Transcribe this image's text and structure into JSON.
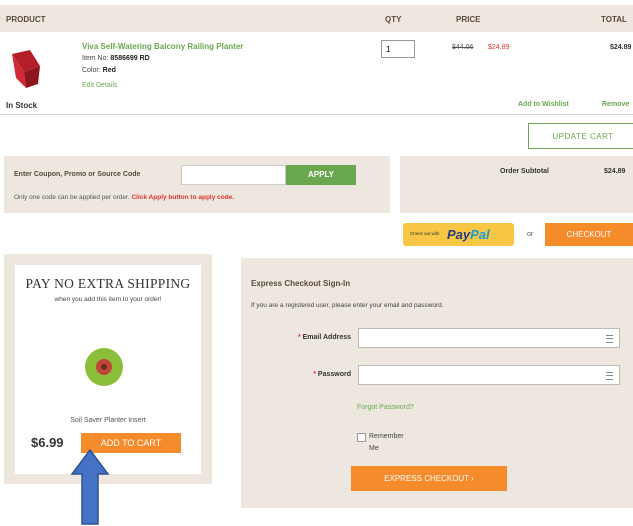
{
  "table_header": {
    "product": "PRODUCT",
    "qty": "QTY",
    "price": "PRICE",
    "total": "TOTAL"
  },
  "item": {
    "name": "Viva Self-Watering Balcony Railing Planter",
    "item_no_label": "Item No:",
    "item_no": "8586699 RD",
    "color_label": "Color:",
    "color": "Red",
    "edit_link": "Edit Details",
    "qty": "1",
    "price_old": "$44.06",
    "price_new": "$24.89",
    "total": "$24.89",
    "stock": "In Stock",
    "wishlist_link": "Add to Wishlist",
    "remove_link": "Remove"
  },
  "update_cart": "UPDATE CART",
  "coupon": {
    "label": "Enter Coupon, Promo or Source Code",
    "placeholder": "",
    "apply": "APPLY",
    "note": "Only one code can be applied per order.",
    "note_highlight": "Click Apply button to apply code."
  },
  "summary": {
    "subtotal_label": "Order Subtotal",
    "subtotal_value": "$24.89"
  },
  "paypal": {
    "small_text": "Check out with",
    "brand_a": "Pay",
    "brand_b": "Pal"
  },
  "or_text": "or",
  "checkout": "CHECKOUT",
  "promo": {
    "title": "PAY NO EXTRA SHIPPING",
    "subtitle": "when you add this item to your order!",
    "product_name": "Soil Saver Planter Insert",
    "price": "$6.99",
    "button": "ADD TO CART"
  },
  "express": {
    "title": "Express Checkout Sign-In",
    "desc": "If you are a registered user, please enter your email and password.",
    "email_label": "Email Address",
    "password_label": "Password",
    "required_mark": "*",
    "forgot": "Forgot Password?",
    "remember_a": "Remember",
    "remember_b": "Me",
    "button": "EXPRESS CHECKOUT ›"
  },
  "colors": {
    "accent_green": "#6aa84f",
    "orange": "#f58b2a",
    "sale_red": "#d9352a",
    "panel": "#ede7e0",
    "arrow_blue": "#4472c4"
  }
}
